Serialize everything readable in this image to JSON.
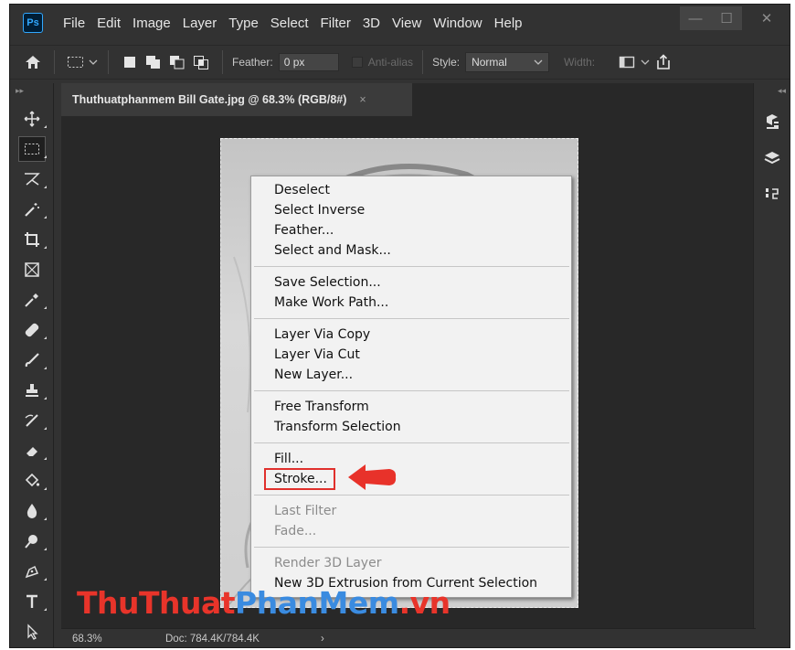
{
  "app": {
    "logo": "Ps"
  },
  "menubar": {
    "items": [
      "File",
      "Edit",
      "Image",
      "Layer",
      "Type",
      "Select",
      "Filter",
      "3D",
      "View",
      "Window",
      "Help"
    ]
  },
  "window_controls": {
    "minimize": "—",
    "maximize": "☐",
    "close": "✕"
  },
  "options_bar": {
    "feather_label": "Feather:",
    "feather_value": "0 px",
    "antialias_label": "Anti-alias",
    "style_label": "Style:",
    "style_value": "Normal",
    "width_label": "Width:"
  },
  "document_tab": {
    "title": "Thuthuatphanmem Bill Gate.jpg @ 68.3% (RGB/8#)",
    "close": "×"
  },
  "status_bar": {
    "zoom": "68.3%",
    "doc_info": "Doc: 784.4K/784.4K",
    "chevron": "›"
  },
  "context_menu": {
    "groups": [
      [
        {
          "label": "Deselect",
          "enabled": true
        },
        {
          "label": "Select Inverse",
          "enabled": true
        },
        {
          "label": "Feather...",
          "enabled": true
        },
        {
          "label": "Select and Mask...",
          "enabled": true
        }
      ],
      [
        {
          "label": "Save Selection...",
          "enabled": true
        },
        {
          "label": "Make Work Path...",
          "enabled": true
        }
      ],
      [
        {
          "label": "Layer Via Copy",
          "enabled": true
        },
        {
          "label": "Layer Via Cut",
          "enabled": true
        },
        {
          "label": "New Layer...",
          "enabled": true
        }
      ],
      [
        {
          "label": "Free Transform",
          "enabled": true
        },
        {
          "label": "Transform Selection",
          "enabled": true
        }
      ],
      [
        {
          "label": "Fill...",
          "enabled": true
        },
        {
          "label": "Stroke...",
          "enabled": true,
          "highlighted": true
        }
      ],
      [
        {
          "label": "Last Filter",
          "enabled": false
        },
        {
          "label": "Fade...",
          "enabled": false
        }
      ],
      [
        {
          "label": "Render 3D Layer",
          "enabled": false
        },
        {
          "label": "New 3D Extrusion from Current Selection",
          "enabled": true
        }
      ]
    ]
  },
  "watermark": {
    "part1": "ThuThuat",
    "part2": "PhanMem",
    "part3": ".vn"
  },
  "colors": {
    "highlight": "#e0302c",
    "ps_blue": "#31a8ff",
    "watermark_red": "#e8342a",
    "watermark_blue": "#3a8be0"
  },
  "tools": [
    "move-icon",
    "rectangular-marquee-icon",
    "lasso-icon",
    "magic-wand-icon",
    "crop-icon",
    "frame-icon",
    "eyedropper-icon",
    "healing-brush-icon",
    "brush-icon",
    "clone-stamp-icon",
    "history-brush-icon",
    "eraser-icon",
    "paint-bucket-icon",
    "blur-icon",
    "dodge-icon",
    "pen-icon",
    "type-icon",
    "path-selection-icon"
  ]
}
